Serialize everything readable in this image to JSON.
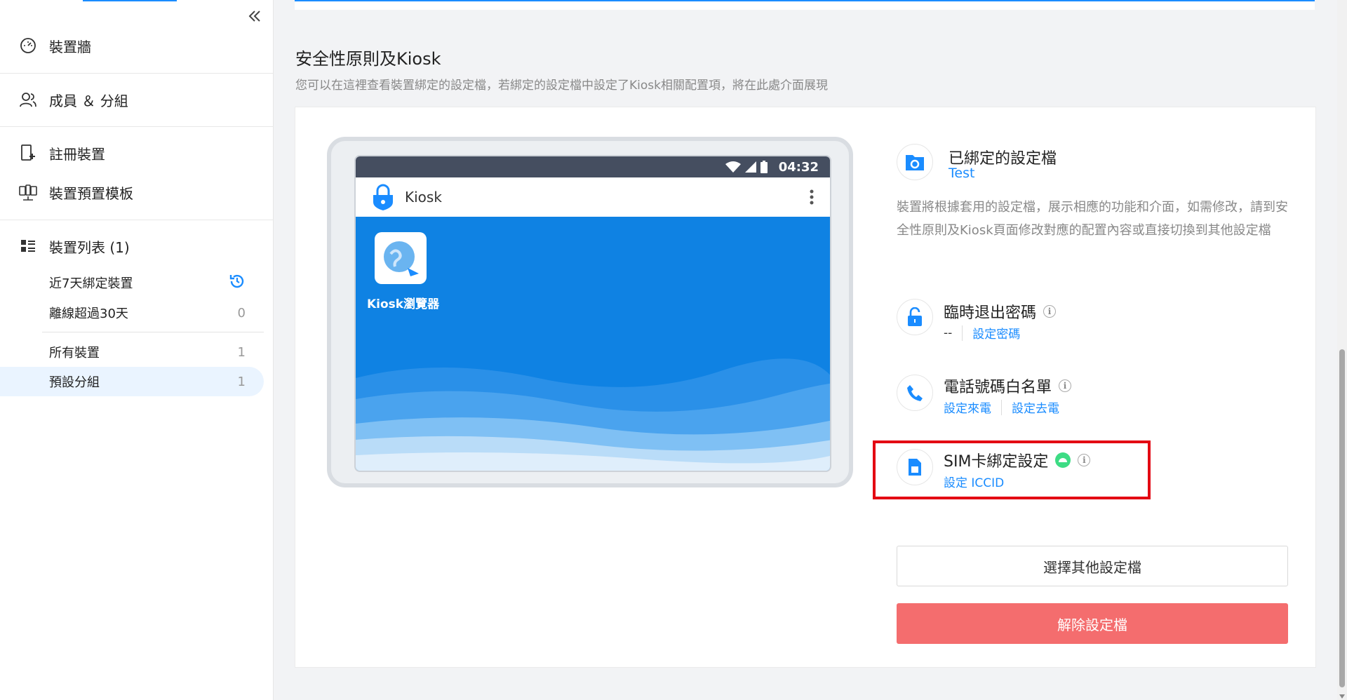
{
  "sidebar": {
    "nav": {
      "dashboard": "裝置牆",
      "members": "成員 ＆ 分組",
      "register": "註冊裝置",
      "template": "裝置預置模板",
      "device_list": "裝置列表 (1)"
    },
    "sub": {
      "recent": {
        "label": "近7天綁定裝置"
      },
      "offline": {
        "label": "離線超過30天",
        "count": "0"
      },
      "all": {
        "label": "所有裝置",
        "count": "1"
      },
      "default_group": {
        "label": "預設分組",
        "count": "1"
      }
    }
  },
  "section": {
    "title": "安全性原則及Kiosk",
    "description": "您可以在這裡查看裝置綁定的設定檔，若綁定的設定檔中設定了Kiosk相關配置項，將在此處介面展現"
  },
  "tablet": {
    "time": "04:32",
    "app_name": "Kiosk",
    "icon_label": "Kiosk瀏覽器"
  },
  "profile": {
    "title": "已綁定的設定檔",
    "name": "Test",
    "description": "裝置將根據套用的設定檔，展示相應的功能和介面，如需修改，請到安全性原則及Kiosk頁面修改對應的配置內容或直接切換到其他設定檔"
  },
  "exit_password": {
    "title": "臨時退出密碼",
    "value": "--",
    "link": "設定密碼"
  },
  "phone_whitelist": {
    "title": "電話號碼白名單",
    "incoming": "設定來電",
    "outgoing": "設定去電"
  },
  "sim": {
    "title": "SIM卡綁定設定",
    "link": "設定 ICCID"
  },
  "buttons": {
    "choose_other": "選擇其他設定檔",
    "unbind": "解除設定檔"
  },
  "colors": {
    "accent": "#1a8cff",
    "danger": "#f46d6e",
    "highlight": "#e30613",
    "android": "#3ddc84"
  }
}
